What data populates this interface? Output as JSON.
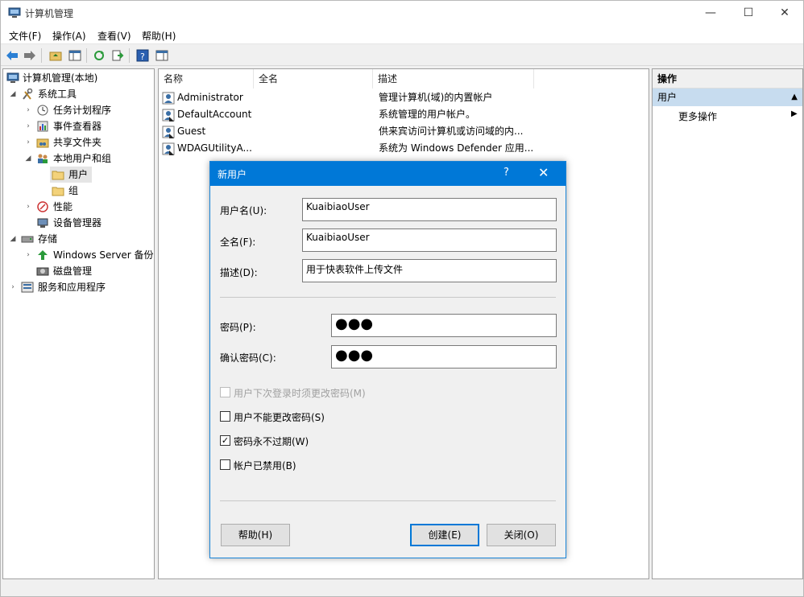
{
  "window": {
    "title": "计算机管理",
    "controls": {
      "minimize": "—",
      "maximize": "☐",
      "close": "✕"
    }
  },
  "menu": {
    "file": "文件(F)",
    "action": "操作(A)",
    "view": "查看(V)",
    "help": "帮助(H)"
  },
  "tree": {
    "root": "计算机管理(本地)",
    "system_tools": "系统工具",
    "task_scheduler": "任务计划程序",
    "event_viewer": "事件查看器",
    "shared_folders": "共享文件夹",
    "local_users_groups": "本地用户和组",
    "users": "用户",
    "groups": "组",
    "performance": "性能",
    "device_manager": "设备管理器",
    "storage": "存储",
    "windows_server_backup": "Windows Server 备份",
    "disk_management": "磁盘管理",
    "services_apps": "服务和应用程序"
  },
  "list": {
    "columns": {
      "name": "名称",
      "fullname": "全名",
      "description": "描述"
    },
    "rows": [
      {
        "name": "Administrator",
        "fullname": "",
        "description": "管理计算机(域)的内置帐户"
      },
      {
        "name": "DefaultAccount",
        "fullname": "",
        "description": "系统管理的用户帐户。"
      },
      {
        "name": "Guest",
        "fullname": "",
        "description": "供来宾访问计算机或访问域的内..."
      },
      {
        "name": "WDAGUtilityA...",
        "fullname": "",
        "description": "系统为 Windows Defender 应用..."
      }
    ]
  },
  "actions": {
    "title": "操作",
    "section": "用户",
    "more": "更多操作"
  },
  "dialog": {
    "title": "新用户",
    "help_icon": "?",
    "close_icon": "✕",
    "username_label": "用户名(U):",
    "username_value": "KuaibiaoUser",
    "fullname_label": "全名(F):",
    "fullname_value": "KuaibiaoUser",
    "description_label": "描述(D):",
    "description_value": "用于快表软件上传文件",
    "password_label": "密码(P):",
    "password_value": "●●●",
    "confirm_label": "确认密码(C):",
    "confirm_value": "●●●",
    "chk_must_change": "用户下次登录时须更改密码(M)",
    "chk_cannot_change": "用户不能更改密码(S)",
    "chk_never_expires": "密码永不过期(W)",
    "chk_disabled": "帐户已禁用(B)",
    "btn_help": "帮助(H)",
    "btn_create": "创建(E)",
    "btn_close": "关闭(O)",
    "checkmark": "✓"
  },
  "colors": {
    "accent": "#0078d7",
    "selection": "#c7dcef"
  }
}
